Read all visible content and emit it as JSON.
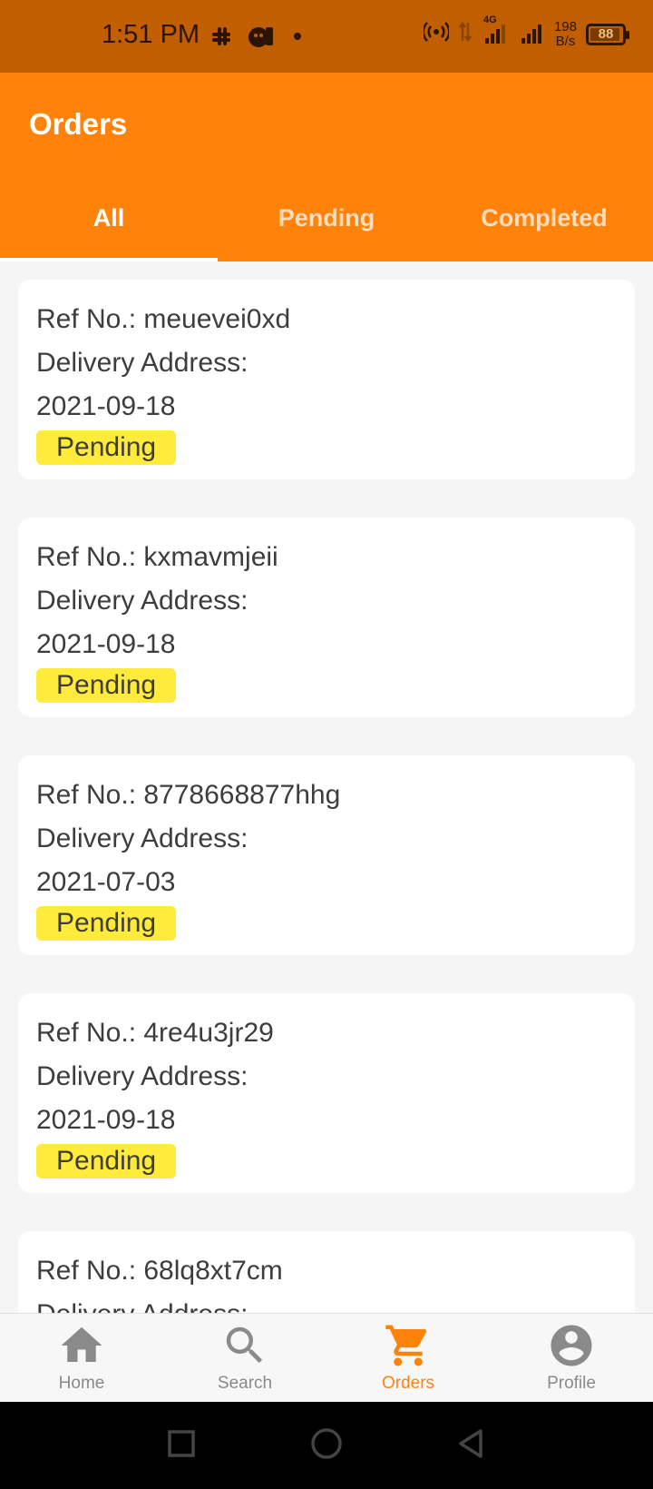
{
  "status_bar": {
    "time": "1:51 PM",
    "network_type": "4G",
    "net_speed_value": "198",
    "net_speed_unit": "B/s",
    "battery_level": "88"
  },
  "app_bar": {
    "title": "Orders"
  },
  "tabs": [
    {
      "label": "All",
      "active": true
    },
    {
      "label": "Pending",
      "active": false
    },
    {
      "label": "Completed",
      "active": false
    }
  ],
  "orders": [
    {
      "ref": "Ref No.: meuevei0xd",
      "address": "Delivery Address:",
      "date": "2021-09-18",
      "status": "Pending"
    },
    {
      "ref": "Ref No.: kxmavmjeii",
      "address": "Delivery Address:",
      "date": "2021-09-18",
      "status": "Pending"
    },
    {
      "ref": "Ref No.: 8778668877hhg",
      "address": "Delivery Address:",
      "date": "2021-07-03",
      "status": "Pending"
    },
    {
      "ref": "Ref No.: 4re4u3jr29",
      "address": "Delivery Address:",
      "date": "2021-09-18",
      "status": "Pending"
    },
    {
      "ref": "Ref No.: 68lq8xt7cm",
      "address": "Delivery Address:",
      "date": "",
      "status": ""
    }
  ],
  "bottom_nav": [
    {
      "label": "Home",
      "icon": "home-icon",
      "active": false
    },
    {
      "label": "Search",
      "icon": "search-icon",
      "active": false
    },
    {
      "label": "Orders",
      "icon": "cart-icon",
      "active": true
    },
    {
      "label": "Profile",
      "icon": "profile-icon",
      "active": false
    }
  ],
  "colors": {
    "primary": "#ff820b",
    "status_bar": "#c15f00",
    "pending_badge": "#ffeb3b",
    "background": "#f5f5f5"
  }
}
